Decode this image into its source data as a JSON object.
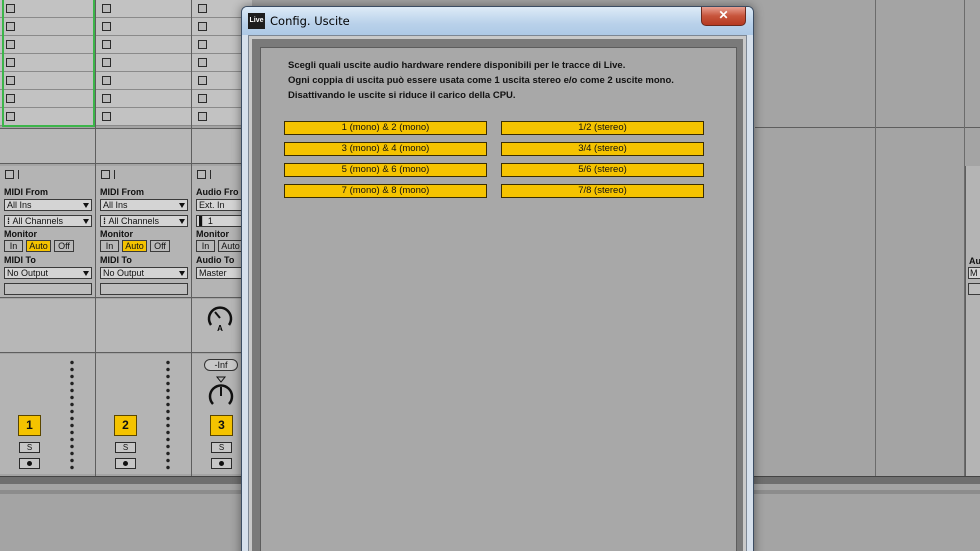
{
  "tracks": [
    {
      "input_type_label": "MIDI From",
      "input_source": "All Ins",
      "input_channel": "All Channels",
      "monitor_label": "Monitor",
      "monitor_in": "In",
      "monitor_auto": "Auto",
      "monitor_off": "Off",
      "output_label": "MIDI To",
      "output_target": "No Output",
      "number": "1",
      "solo": "S"
    },
    {
      "input_type_label": "MIDI From",
      "input_source": "All Ins",
      "input_channel": "All Channels",
      "monitor_label": "Monitor",
      "monitor_in": "In",
      "monitor_auto": "Auto",
      "monitor_off": "Off",
      "output_label": "MIDI To",
      "output_target": "No Output",
      "number": "2",
      "solo": "S"
    },
    {
      "input_type_label": "Audio Fro",
      "input_source": "Ext. In",
      "input_channel": "1",
      "monitor_label": "Monitor",
      "monitor_in": "In",
      "monitor_auto": "Auto",
      "output_label": "Audio To",
      "output_target": "Master",
      "number": "3",
      "solo": "S",
      "volume": "-Inf",
      "send_label": "A"
    }
  ],
  "right_partial": {
    "label": "Au",
    "value": "M"
  },
  "dialog": {
    "title": "Config. Uscite",
    "app_icon": "Live",
    "close": "✕",
    "description": [
      "Scegli quali uscite audio hardware rendere disponibili per le tracce di Live.",
      "Ogni coppia di uscita può essere usata come 1 uscita stereo e/o come 2 uscite mono.",
      "Disattivando le uscite si riduce il carico della CPU."
    ],
    "mono_outputs": [
      "1 (mono) & 2 (mono)",
      "3 (mono) & 4 (mono)",
      "5 (mono) & 6 (mono)",
      "7 (mono) & 8 (mono)"
    ],
    "stereo_outputs": [
      "1/2 (stereo)",
      "3/4 (stereo)",
      "5/6 (stereo)",
      "7/8 (stereo)"
    ]
  },
  "colors": {
    "accent": "#f5c300",
    "selection": "#3cb54a",
    "panel": "#a8a8a8"
  }
}
